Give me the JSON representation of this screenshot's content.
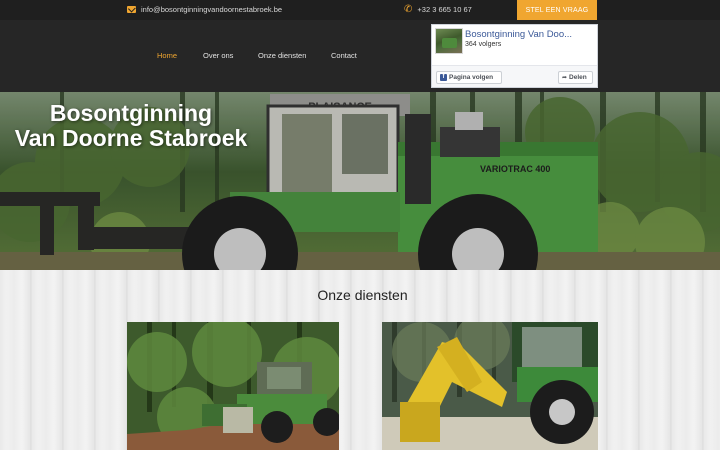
{
  "topbar": {
    "email": "info@bosontginningvandoornestabroek.be",
    "phone": "+32 3 665 10 67",
    "cta_label": "STEL EEN VRAAG",
    "email_icon": "envelope-icon",
    "phone_icon": "phone-icon"
  },
  "nav": {
    "items": [
      {
        "label": "Home"
      },
      {
        "label": "Over ons"
      },
      {
        "label": "Onze diensten"
      },
      {
        "label": "Contact"
      }
    ],
    "active_color": "#f0a630"
  },
  "facebook": {
    "page_name": "Bosontginning Van Doo...",
    "followers": "364 volgers",
    "follow_label": "Pagina volgen",
    "share_label": "Delen"
  },
  "hero": {
    "title_line1": "Bosontginning",
    "title_line2": "Van Doorne Stabroek",
    "vehicle_text_top": "PLAISANCE",
    "vehicle_text_side": "VARIOTRAC 400"
  },
  "services": {
    "heading": "Onze diensten"
  },
  "colors": {
    "accent": "#f0a630",
    "dark": "#262626",
    "facebook_blue": "#3b5998"
  }
}
